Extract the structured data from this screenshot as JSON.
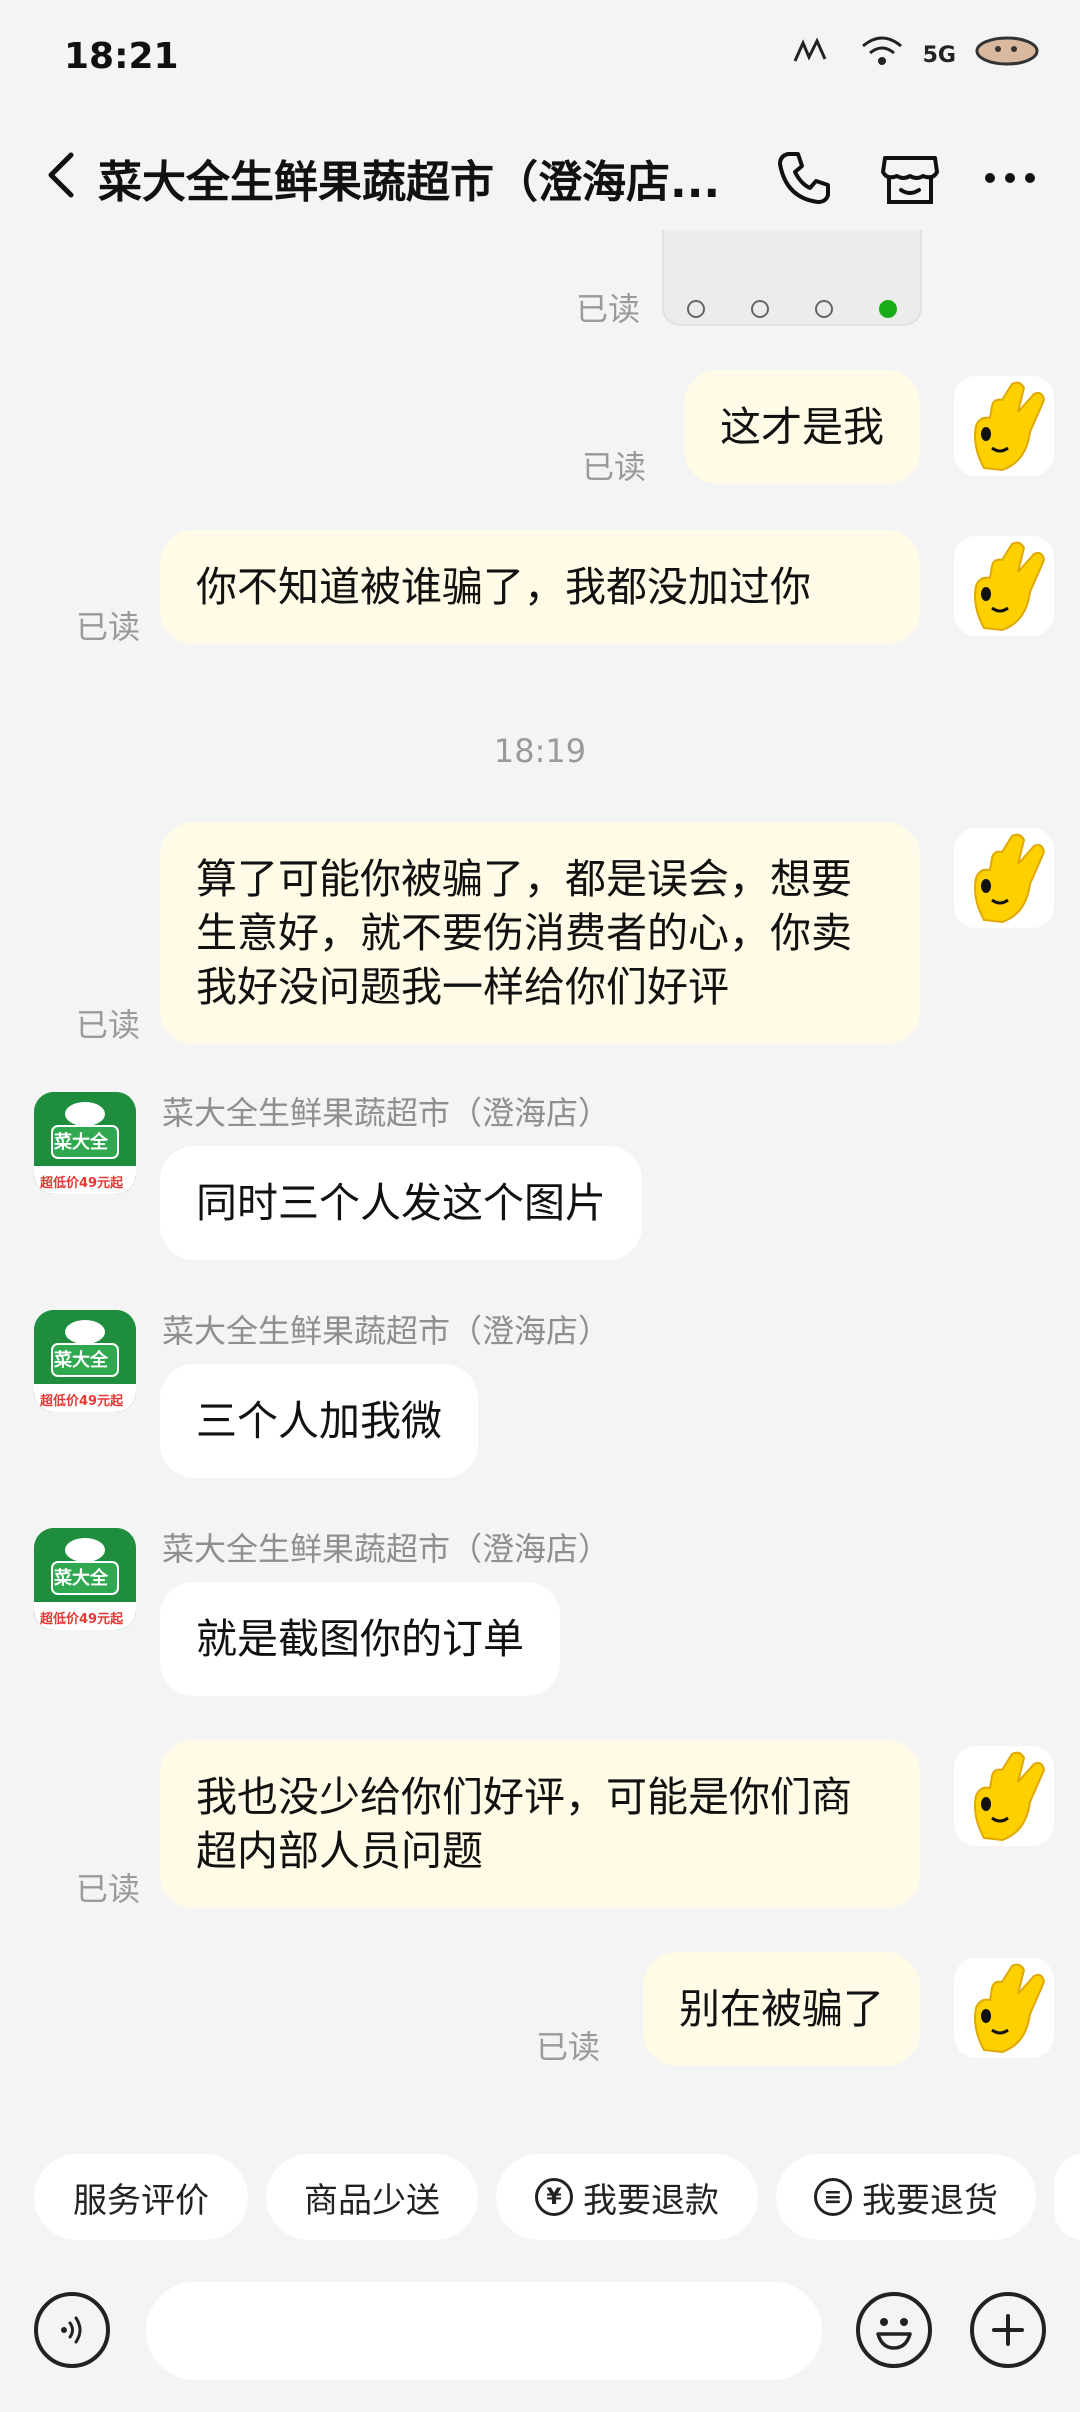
{
  "status_bar": {
    "time": "18:21",
    "network": "5G"
  },
  "header": {
    "title": "菜大全生鲜果蔬超市（澄海店..."
  },
  "read_label": "已读",
  "timestamp": "18:19",
  "messages": [
    {
      "from": "me",
      "text": "这才是我"
    },
    {
      "from": "me",
      "text": "你不知道被谁骗了，我都没加过你"
    },
    {
      "from": "me",
      "text": "算了可能你被骗了，都是误会，想要生意好，就不要伤消费者的心，你卖我好没问题我一样给你们好评"
    },
    {
      "from": "shop",
      "sender": "菜大全生鲜果蔬超市（澄海店）",
      "text": "同时三个人发这个图片"
    },
    {
      "from": "shop",
      "sender": "菜大全生鲜果蔬超市（澄海店）",
      "text": "三个人加我微"
    },
    {
      "from": "shop",
      "sender": "菜大全生鲜果蔬超市（澄海店）",
      "text": "就是截图你的订单"
    },
    {
      "from": "me",
      "text": "我也没少给你们好评，可能是你们商超内部人员问题"
    },
    {
      "from": "me",
      "text": "别在被骗了"
    }
  ],
  "shop_avatar": {
    "name": "菜大全",
    "promo": "超低价49元起"
  },
  "quick_replies": [
    {
      "label": "服务评价",
      "icon": ""
    },
    {
      "label": "商品少送",
      "icon": ""
    },
    {
      "label": "我要退款",
      "icon": "yen-icon"
    },
    {
      "label": "我要退货",
      "icon": "return-goods-icon"
    }
  ],
  "input": {
    "placeholder": ""
  },
  "colors": {
    "my_bubble": "#fffbe6",
    "their_bubble": "#ffffff",
    "background": "#f4f4f4",
    "shop_green": "#1e8e3e"
  }
}
